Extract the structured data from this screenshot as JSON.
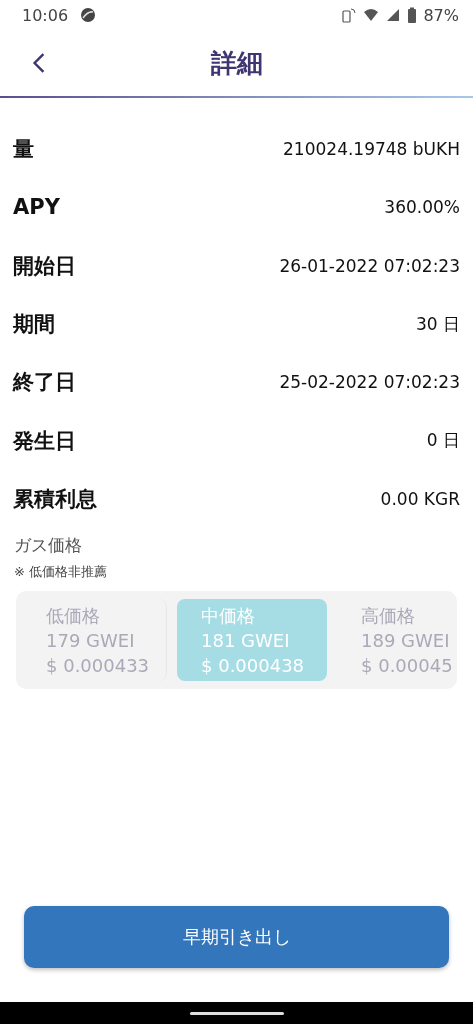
{
  "status_bar": {
    "time": "10:06",
    "battery": "87%"
  },
  "header": {
    "title": "詳細"
  },
  "details": [
    {
      "label": "量",
      "value": "210024.19748 bUKH"
    },
    {
      "label": "APY",
      "value": "360.00%"
    },
    {
      "label": "開始日",
      "value": "26-01-2022 07:02:23"
    },
    {
      "label": "期間",
      "value": "30 日"
    },
    {
      "label": "終了日",
      "value": "25-02-2022 07:02:23"
    },
    {
      "label": "発生日",
      "value": "0 日"
    },
    {
      "label": "累積利息",
      "value": "0.00 KGR"
    }
  ],
  "gas": {
    "title": "ガス価格",
    "note": "※ 低価格非推薦",
    "options": [
      {
        "name": "低価格",
        "gwei": "179 GWEI",
        "usd": "$ 0.000433",
        "selected": false
      },
      {
        "name": "中価格",
        "gwei": "181 GWEI",
        "usd": "$ 0.000438",
        "selected": true
      },
      {
        "name": "高価格",
        "gwei": "189 GWEI",
        "usd": "$ 0.00045",
        "selected": false
      }
    ]
  },
  "button": {
    "label": "早期引き出し"
  }
}
